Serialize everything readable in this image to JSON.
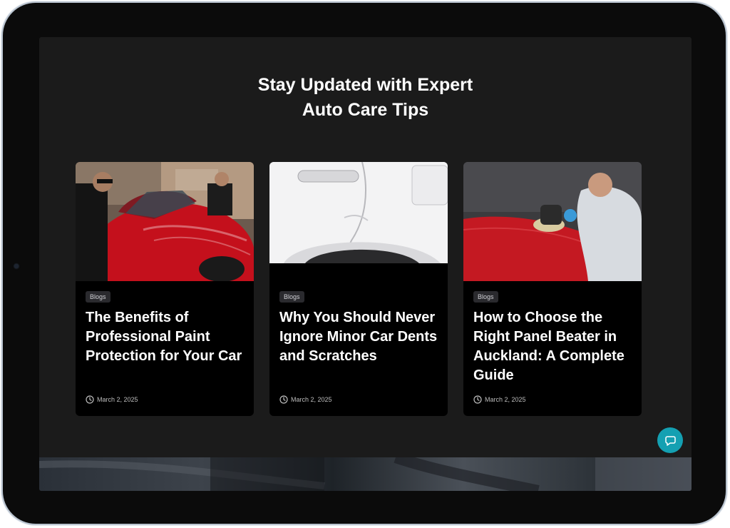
{
  "section": {
    "title_line1": "Stay Updated with Expert",
    "title_line2": "Auto Care Tips"
  },
  "posts": [
    {
      "category": "Blogs",
      "title": "The Benefits of Professional Paint Protection for Your Car",
      "date": "March 2, 2025",
      "image_icon": "car-paint-protection-photo"
    },
    {
      "category": "Blogs",
      "title": "Why You Should Never Ignore Minor Car Dents and Scratches",
      "date": "March 2, 2025",
      "image_icon": "car-dent-photo"
    },
    {
      "category": "Blogs",
      "title": "How to Choose the Right Panel Beater in Auckland: A Complete Guide",
      "date": "March 2, 2025",
      "image_icon": "panel-beater-photo"
    }
  ],
  "colors": {
    "page_bg": "#1b1b1b",
    "card_bg": "#000000",
    "accent": "#14a0b2",
    "badge_bg": "#2a2a2e"
  },
  "icons": {
    "clock": "clock-icon",
    "chat": "chat-bubble-icon"
  }
}
